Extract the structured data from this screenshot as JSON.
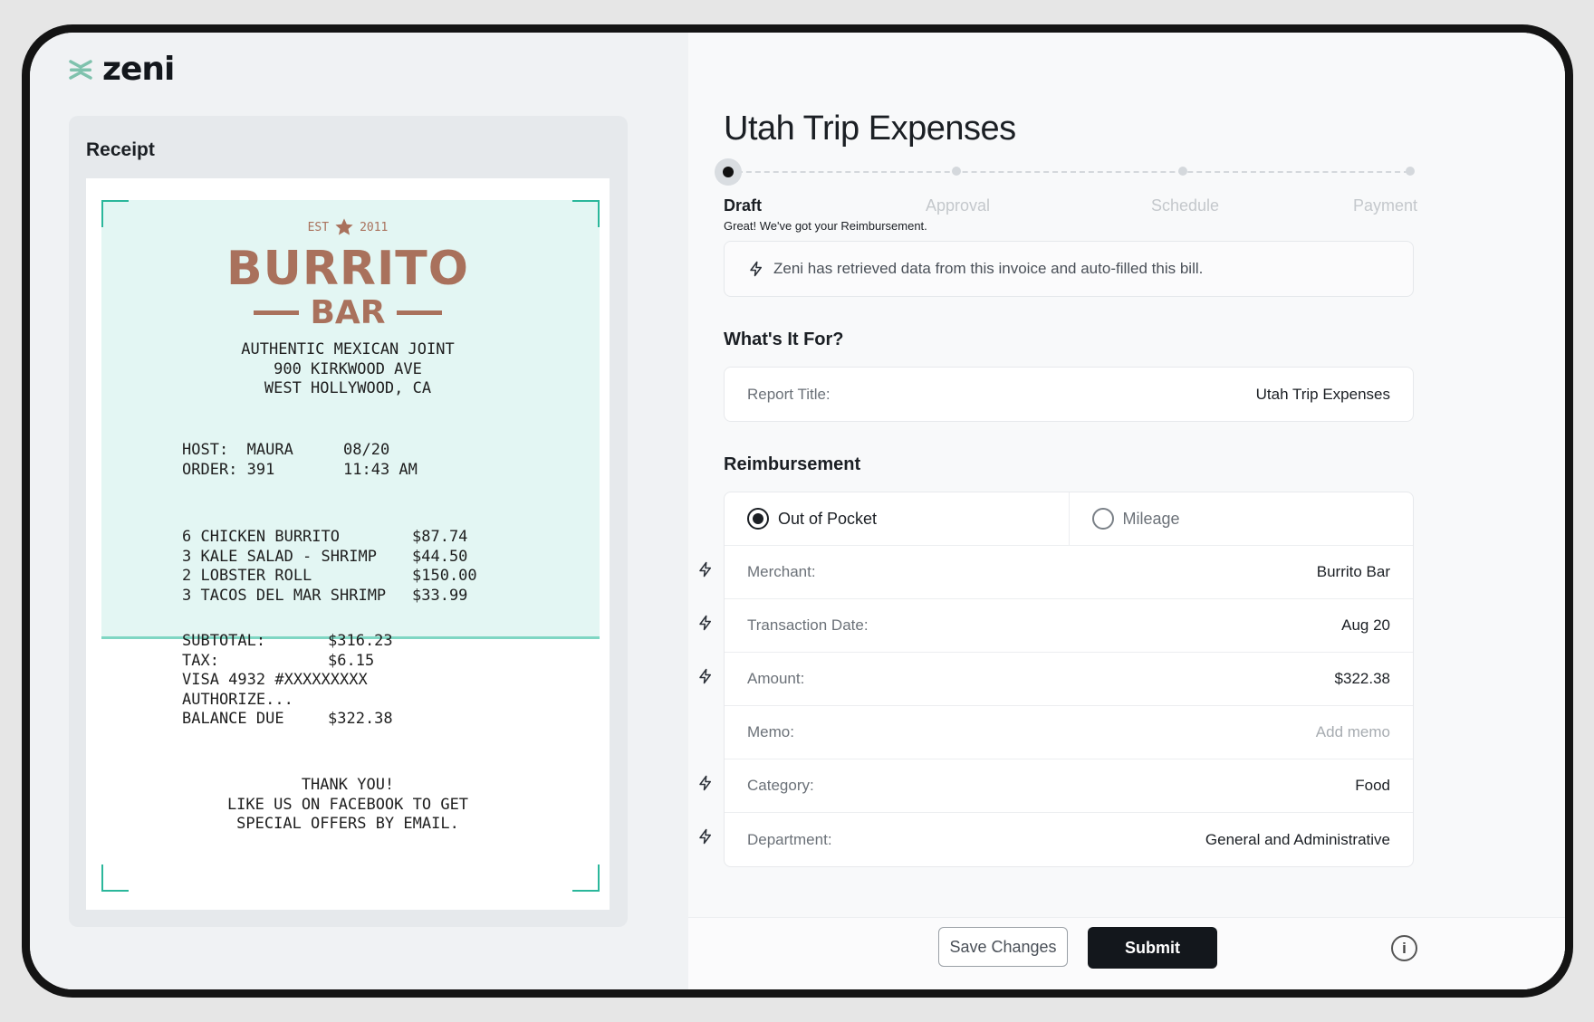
{
  "brand": {
    "name": "zeni"
  },
  "receipt": {
    "heading": "Receipt",
    "est_left": "EST",
    "est_right": "2011",
    "name_line1": "BURRITO",
    "name_line2": "BAR",
    "address": "AUTHENTIC MEXICAN JOINT\n900 KIRKWOOD AVE\nWEST HOLLYWOOD, CA",
    "host_labels": "HOST:  MAURA\nORDER: 391",
    "host_values": "08/20\n11:43 AM",
    "items": "6 CHICKEN BURRITO\n3 KALE SALAD - SHRIMP\n2 LOBSTER ROLL\n3 TACOS DEL MAR SHRIMP",
    "prices": "$87.74\n$44.50\n$150.00\n$33.99",
    "totals_labels": "SUBTOTAL:\nTAX:\nVISA 4932 #XXXXXXXXX\nAUTHORIZE...\nBALANCE DUE",
    "totals_values": "$316.23\n$6.15\n\n\n$322.38",
    "thanks": "THANK YOU!\nLIKE US ON FACEBOOK TO GET\nSPECIAL OFFERS BY EMAIL."
  },
  "report": {
    "title": "Utah Trip Expenses",
    "steps": [
      "Draft",
      "Approval",
      "Schedule",
      "Payment"
    ],
    "step_message": "Great! We've got your Reimbursement.",
    "notice": "Zeni has retrieved data from this invoice and auto-filled this bill."
  },
  "what_for": {
    "heading": "What's It For?",
    "report_title_label": "Report Title:",
    "report_title_value": "Utah Trip Expenses"
  },
  "reimbursement": {
    "heading": "Reimbursement",
    "options": [
      "Out of Pocket",
      "Mileage"
    ],
    "selected": "Out of Pocket",
    "fields": [
      {
        "label": "Merchant:",
        "value": "Burrito Bar"
      },
      {
        "label": "Transaction Date:",
        "value": "Aug 20"
      },
      {
        "label": "Amount:",
        "value": "$322.38"
      },
      {
        "label": "Memo:",
        "value": "Add memo"
      },
      {
        "label": "Category:",
        "value": "Food"
      },
      {
        "label": "Department:",
        "value": "General and Administrative"
      }
    ]
  },
  "footer": {
    "save": "Save Changes",
    "submit": "Submit",
    "more": "i"
  },
  "colors": {
    "accent": "#13171c",
    "scan": "#2bb79b",
    "receipt_brand": "#a9715c"
  },
  "icons": [
    "zeni-logo-icon",
    "bolt-icon",
    "star-icon",
    "more-info-icon"
  ]
}
